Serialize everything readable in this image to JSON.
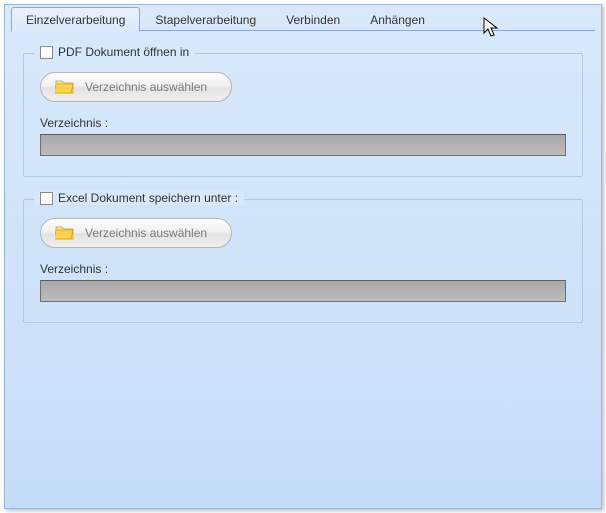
{
  "tabs": {
    "single": "Einzelverarbeitung",
    "batch": "Stapelverarbeitung",
    "connect": "Verbinden",
    "attach": "Anhängen"
  },
  "group1": {
    "legend": "PDF Dokument öffnen in",
    "button": "Verzeichnis auswählen",
    "dirLabel": "Verzeichnis :",
    "dirValue": ""
  },
  "group2": {
    "legend": "Excel Dokument speichern unter :",
    "button": "Verzeichnis auswählen",
    "dirLabel": "Verzeichnis :",
    "dirValue": ""
  }
}
